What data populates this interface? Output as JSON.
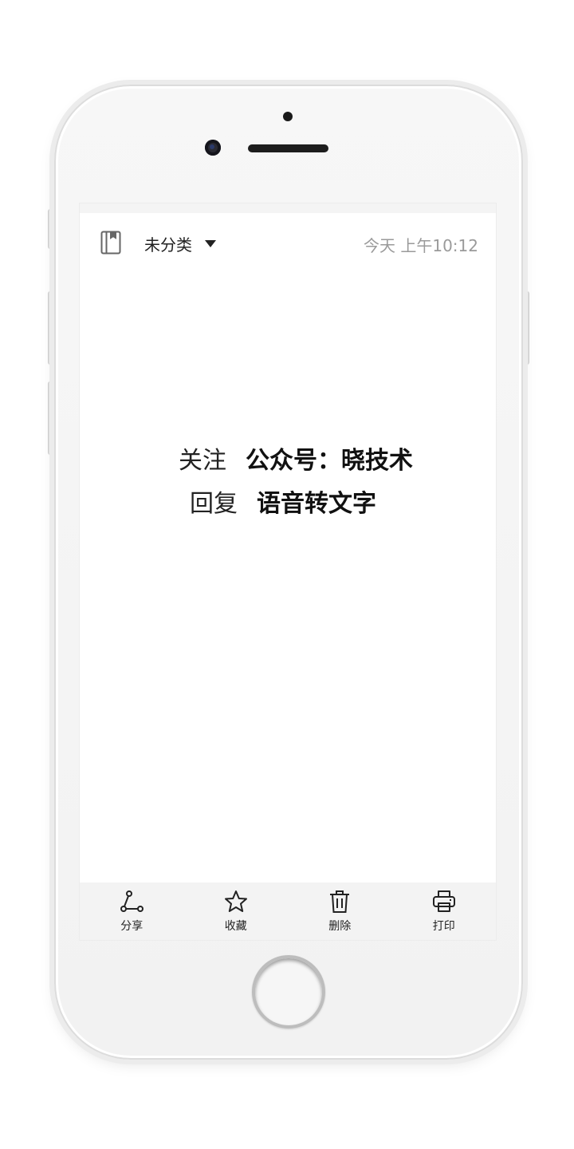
{
  "header": {
    "category": "未分类",
    "timestamp": "今天 上午10:12"
  },
  "note": {
    "line1_label": "关注",
    "line1_value": "公众号：晓技术",
    "line2_label": "回复",
    "line2_value": "语音转文字"
  },
  "toolbar": {
    "share_label": "分享",
    "favorite_label": "收藏",
    "delete_label": "删除",
    "print_label": "打印"
  },
  "icons": {
    "notebook": "notebook-icon",
    "dropdown": "caret-down-icon",
    "share": "share-icon",
    "favorite": "star-icon",
    "delete": "trash-icon",
    "print": "printer-icon"
  },
  "colors": {
    "timestamp": "#9a9a9a",
    "text": "#222222",
    "toolbar_bg": "#f3f3f3"
  }
}
